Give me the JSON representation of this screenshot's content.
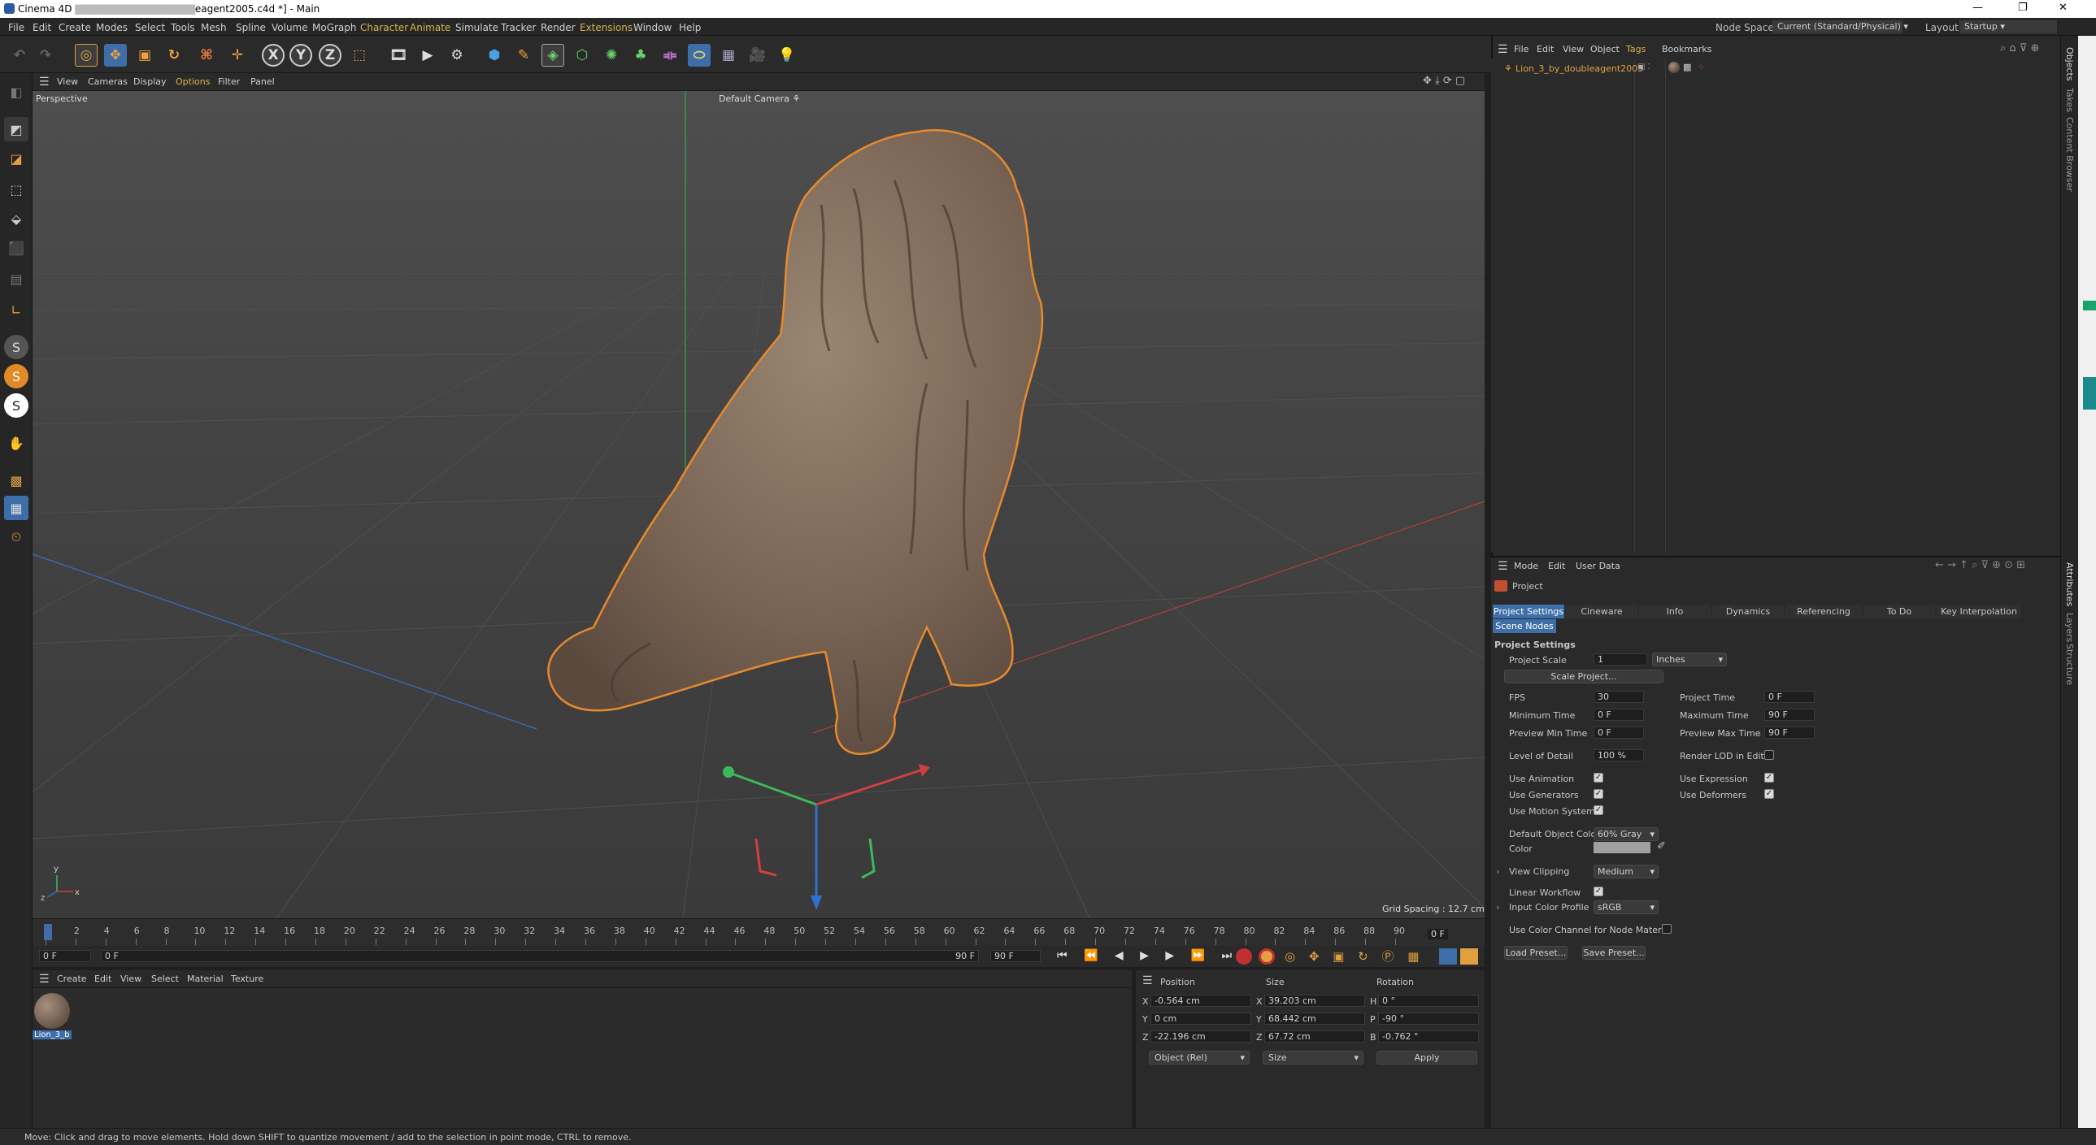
{
  "window": {
    "title": "Cinema 4D",
    "title_suffix": "eagent2005.c4d *] - Main"
  },
  "menus": [
    "File",
    "Edit",
    "Create",
    "Modes",
    "Select",
    "Tools",
    "Mesh",
    "Spline",
    "Volume",
    "MoGraph",
    "Character",
    "Animate",
    "Simulate",
    "Tracker",
    "Render",
    "Extensions",
    "Window",
    "Help"
  ],
  "menu_highlight": [
    "Character",
    "Animate",
    "Extensions"
  ],
  "node_space": {
    "label": "Node Space:",
    "value": "Current (Standard/Physical)"
  },
  "layout": {
    "label": "Layout:",
    "value": "Startup"
  },
  "toolbar": {
    "x": "X",
    "y": "Y",
    "z": "Z"
  },
  "viewport": {
    "menu": [
      "View",
      "Cameras",
      "Display",
      "Options",
      "Filter",
      "Panel"
    ],
    "view_name": "Perspective",
    "camera": "Default Camera",
    "grid_spacing": "Grid Spacing : 12.7 cm"
  },
  "timeline": {
    "ticks": [
      "0",
      "2",
      "4",
      "6",
      "8",
      "10",
      "12",
      "14",
      "16",
      "18",
      "20",
      "22",
      "24",
      "26",
      "28",
      "30",
      "32",
      "34",
      "36",
      "38",
      "40",
      "42",
      "44",
      "46",
      "48",
      "50",
      "52",
      "54",
      "56",
      "58",
      "60",
      "62",
      "64",
      "66",
      "68",
      "70",
      "72",
      "74",
      "76",
      "78",
      "80",
      "82",
      "84",
      "86",
      "88",
      "90"
    ],
    "current": "0 F",
    "start": "0 F",
    "range_start": "0 F",
    "range_end": "90 F",
    "end": "90 F"
  },
  "material_menu": [
    "Create",
    "Edit",
    "View",
    "Select",
    "Material",
    "Texture"
  ],
  "material": {
    "name": "Lion_3_b"
  },
  "coords": {
    "headers": {
      "position": "Position",
      "size": "Size",
      "rotation": "Rotation"
    },
    "axes_pos": [
      "X",
      "Y",
      "Z"
    ],
    "axes_rot": [
      "H",
      "P",
      "B"
    ],
    "position": [
      "-0.564 cm",
      "0 cm",
      "-22.196 cm"
    ],
    "size": [
      "39.203 cm",
      "68.442 cm",
      "67.72 cm"
    ],
    "rotation": [
      "0 °",
      "-90 °",
      "-0.762 °"
    ],
    "mode": "Object (Rel)",
    "size_mode": "Size",
    "apply": "Apply"
  },
  "status": "Move: Click and drag to move elements. Hold down SHIFT to quantize movement / add to the selection in point mode, CTRL to remove.",
  "object_manager": {
    "menu": [
      "File",
      "Edit",
      "View",
      "Object",
      "Tags",
      "Bookmarks"
    ],
    "object": "Lion_3_by_doubleagent2005"
  },
  "attributes": {
    "menu": [
      "Mode",
      "Edit",
      "User Data"
    ],
    "title": "Project",
    "tabs": [
      "Project Settings",
      "Cineware",
      "Info",
      "Dynamics",
      "Referencing",
      "To Do",
      "Key Interpolation"
    ],
    "tab2": "Scene Nodes",
    "section": "Project Settings",
    "project_scale_label": "Project Scale",
    "project_scale": "1",
    "unit": "Inches",
    "scale_project": "Scale Project...",
    "fps_label": "FPS",
    "fps": "30",
    "project_time_label": "Project Time",
    "project_time": "0 F",
    "min_time_label": "Minimum Time",
    "min_time": "0 F",
    "max_time_label": "Maximum Time",
    "max_time": "90 F",
    "prev_min_label": "Preview Min Time",
    "prev_min": "0 F",
    "prev_max_label": "Preview Max Time",
    "prev_max": "90 F",
    "lod_label": "Level of Detail",
    "lod": "100 %",
    "render_lod_label": "Render LOD in Editor",
    "use_anim": "Use Animation",
    "use_expr": "Use Expression",
    "use_gen": "Use Generators",
    "use_def": "Use Deformers",
    "use_motion": "Use Motion System",
    "def_obj_color_label": "Default Object Color",
    "def_obj_color": "60% Gray",
    "color_label": "Color",
    "view_clip_label": "View Clipping",
    "view_clip": "Medium",
    "linear_wf": "Linear Workflow",
    "input_profile_label": "Input Color Profile",
    "input_profile": "sRGB",
    "use_color_channel": "Use Color Channel for Node Material",
    "load_preset": "Load Preset...",
    "save_preset": "Save Preset..."
  },
  "side_tabs": {
    "right_top": [
      "Objects",
      "Takes",
      "Content Browser"
    ],
    "right_bottom": [
      "Attributes",
      "Layers",
      "Structure"
    ]
  },
  "colors": {
    "accent": "#3d6ea8",
    "selection_orange": "#e8892d",
    "y_axis": "#3cba5a",
    "x_axis": "#d04040",
    "z_axis": "#3070d0"
  }
}
